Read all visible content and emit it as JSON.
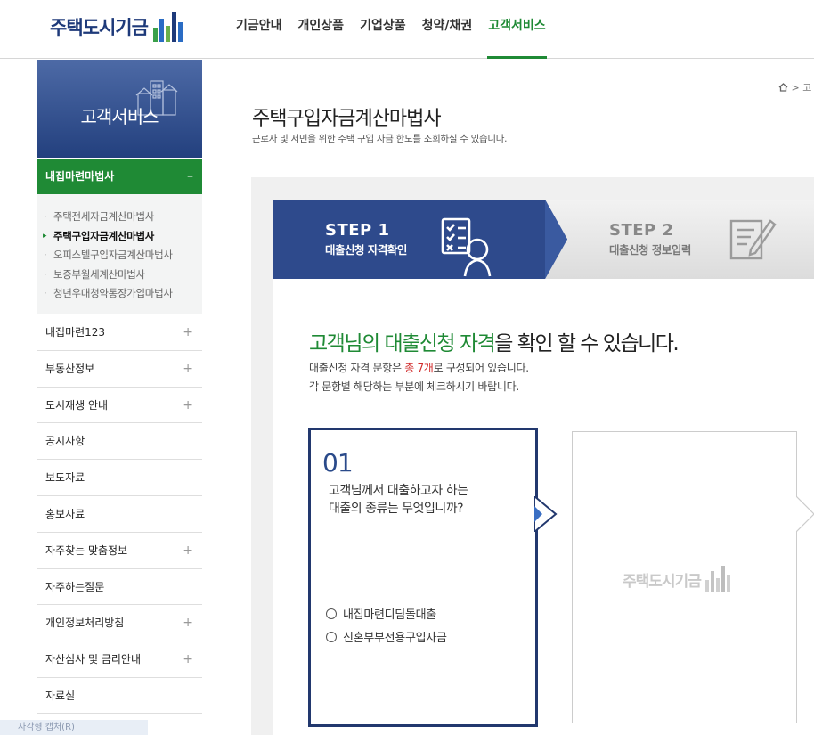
{
  "header": {
    "logo_text": "주택도시기금",
    "nav": [
      "기금안내",
      "개인상품",
      "기업상품",
      "청약/채권",
      "고객서비스"
    ],
    "active_nav_index": 4
  },
  "sidebar": {
    "banner_title": "고객서비스",
    "active_section": {
      "label": "내집마련마법사",
      "toggle": "–"
    },
    "sub_items": [
      {
        "label": "주택전세자금계산마법사",
        "active": false
      },
      {
        "label": "주택구입자금계산마법사",
        "active": true
      },
      {
        "label": "오피스텔구입자금계산마법사",
        "active": false
      },
      {
        "label": "보증부월세계산마법사",
        "active": false
      },
      {
        "label": "청년우대청약통장가입마법사",
        "active": false
      }
    ],
    "menu": [
      {
        "label": "내집마련123",
        "expand": "+"
      },
      {
        "label": "부동산정보",
        "expand": "+"
      },
      {
        "label": "도시재생 안내",
        "expand": "+"
      },
      {
        "label": "공지사항",
        "expand": ""
      },
      {
        "label": "보도자료",
        "expand": ""
      },
      {
        "label": "홍보자료",
        "expand": ""
      },
      {
        "label": "자주찾는 맞춤정보",
        "expand": "+"
      },
      {
        "label": "자주하는질문",
        "expand": ""
      },
      {
        "label": "개인정보처리방침",
        "expand": "+"
      },
      {
        "label": "자산심사 및 금리안내",
        "expand": "+"
      },
      {
        "label": "자료실",
        "expand": ""
      }
    ]
  },
  "breadcrumb": {
    "home_icon": "home-icon",
    "separator": ">",
    "next": "고"
  },
  "page": {
    "title": "주택구입자금계산마법사",
    "description": "근로자 및 서민을 위한 주택 구입 자금 한도를 조회하실 수 있습니다."
  },
  "steps": [
    {
      "num": "STEP 1",
      "label": "대출신청 자격확인",
      "active": true
    },
    {
      "num": "STEP 2",
      "label": "대출신청 정보입력",
      "active": false
    }
  ],
  "intro": {
    "headline_parts": [
      "고객님의 ",
      "대출신청 자격",
      "을 확인 할 수 있습니다."
    ],
    "line1_prefix": "대출신청 자격 문항은 ",
    "line1_highlight": "총 7개",
    "line1_suffix": "로 구성되어 있습니다.",
    "line2": "각 문항별 해당하는 부분에 체크하시기 바랍니다."
  },
  "question": {
    "number": "01",
    "text_line1": "고객님께서 대출하고자 하는",
    "text_line2": "대출의 종류는 무엇입니까?",
    "options": [
      "내집마련디딤돌대출",
      "신혼부부전용구입자금"
    ]
  },
  "next_card": {
    "logo_text": "주택도시기금"
  },
  "taskbar": {
    "text": "사각형 캡처(R)"
  },
  "colors": {
    "navy": "#22386e",
    "green": "#1f8a35",
    "highlight_red": "#d12a2a"
  }
}
